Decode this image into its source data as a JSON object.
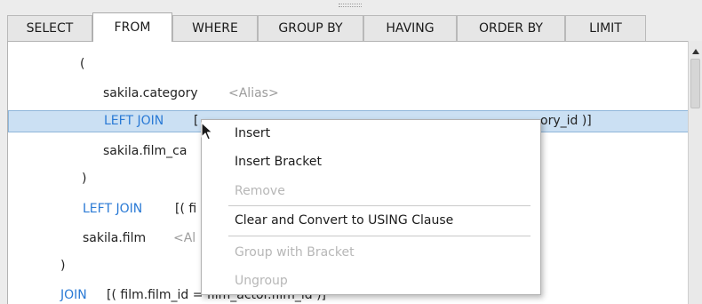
{
  "tabs": [
    "SELECT",
    "FROM",
    "WHERE",
    "GROUP BY",
    "HAVING",
    "ORDER BY",
    "LIMIT"
  ],
  "active_tab": "FROM",
  "tree": {
    "open_paren": "(",
    "table1_name": "sakila.category",
    "table1_alias": "<Alias>",
    "join1_keyword": "LEFT JOIN",
    "join1_condition_start": "[",
    "join1_condition_end": "ory_id )]",
    "table2_name": "sakila.film_ca",
    "close_paren": ")",
    "join2_keyword": "LEFT JOIN",
    "join2_condition": "[( fi",
    "table3_name": "sakila.film",
    "table3_alias": "<Al",
    "outer_close_paren": ")",
    "join3_keyword": "JOIN",
    "join3_condition": "[( film.film_id = film_actor.film_id )]"
  },
  "context_menu": {
    "insert": "Insert",
    "insert_bracket": "Insert Bracket",
    "remove": "Remove",
    "clear_convert": "Clear and Convert to USING Clause",
    "group_with_bracket": "Group with Bracket",
    "ungroup": "Ungroup"
  },
  "colors": {
    "keyword": "#2a7ad5",
    "selection": "#cbe0f3",
    "disabled": "#b7b7b7"
  }
}
